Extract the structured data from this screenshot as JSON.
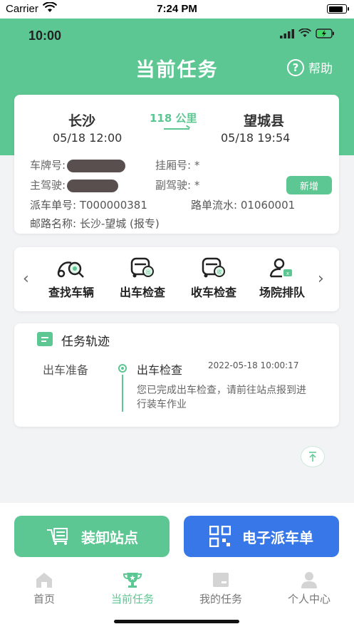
{
  "system_bar": {
    "carrier": "Carrier",
    "time": "7:24 PM",
    "battery_level": 0.85
  },
  "app_status": {
    "time": "10:00"
  },
  "header": {
    "title": "当前任务",
    "help_label": "帮助"
  },
  "task": {
    "from_city": "长沙",
    "to_city": "望城县",
    "distance": "118 公里",
    "depart_time": "05/18 12:00",
    "arrive_time": "05/18 19:54",
    "plate_label": "车牌号:",
    "trailer_label": "挂厢号: *",
    "driver_label": "主驾驶:",
    "co_driver_label": "副驾驶: *",
    "add_label": "新增",
    "dispatch_no": "派车单号: T000000381",
    "route_serial": "路单流水: 01060001",
    "route_name": "邮路名称: 长沙-望城 (报专)"
  },
  "actions": [
    {
      "label": "查找车辆",
      "icon": "find-vehicle-icon"
    },
    {
      "label": "出车检查",
      "icon": "departure-check-icon"
    },
    {
      "label": "收车检查",
      "icon": "return-check-icon"
    },
    {
      "label": "场院排队",
      "icon": "yard-queue-icon"
    }
  ],
  "track": {
    "title": "任务轨迹",
    "stage": "出车准备",
    "event": "出车检查",
    "time": "2022-05-18 10:00:17",
    "description": "您已完成出车检查，请前往站点报到进行装车作业"
  },
  "buttons": {
    "load_unload": "装卸站点",
    "e_dispatch": "电子派车单"
  },
  "tabs": [
    {
      "label": "首页",
      "active": false
    },
    {
      "label": "当前任务",
      "active": true
    },
    {
      "label": "我的任务",
      "active": false
    },
    {
      "label": "个人中心",
      "active": false
    }
  ],
  "colors": {
    "brand_green": "#5cc792",
    "brand_blue": "#3877e8"
  }
}
